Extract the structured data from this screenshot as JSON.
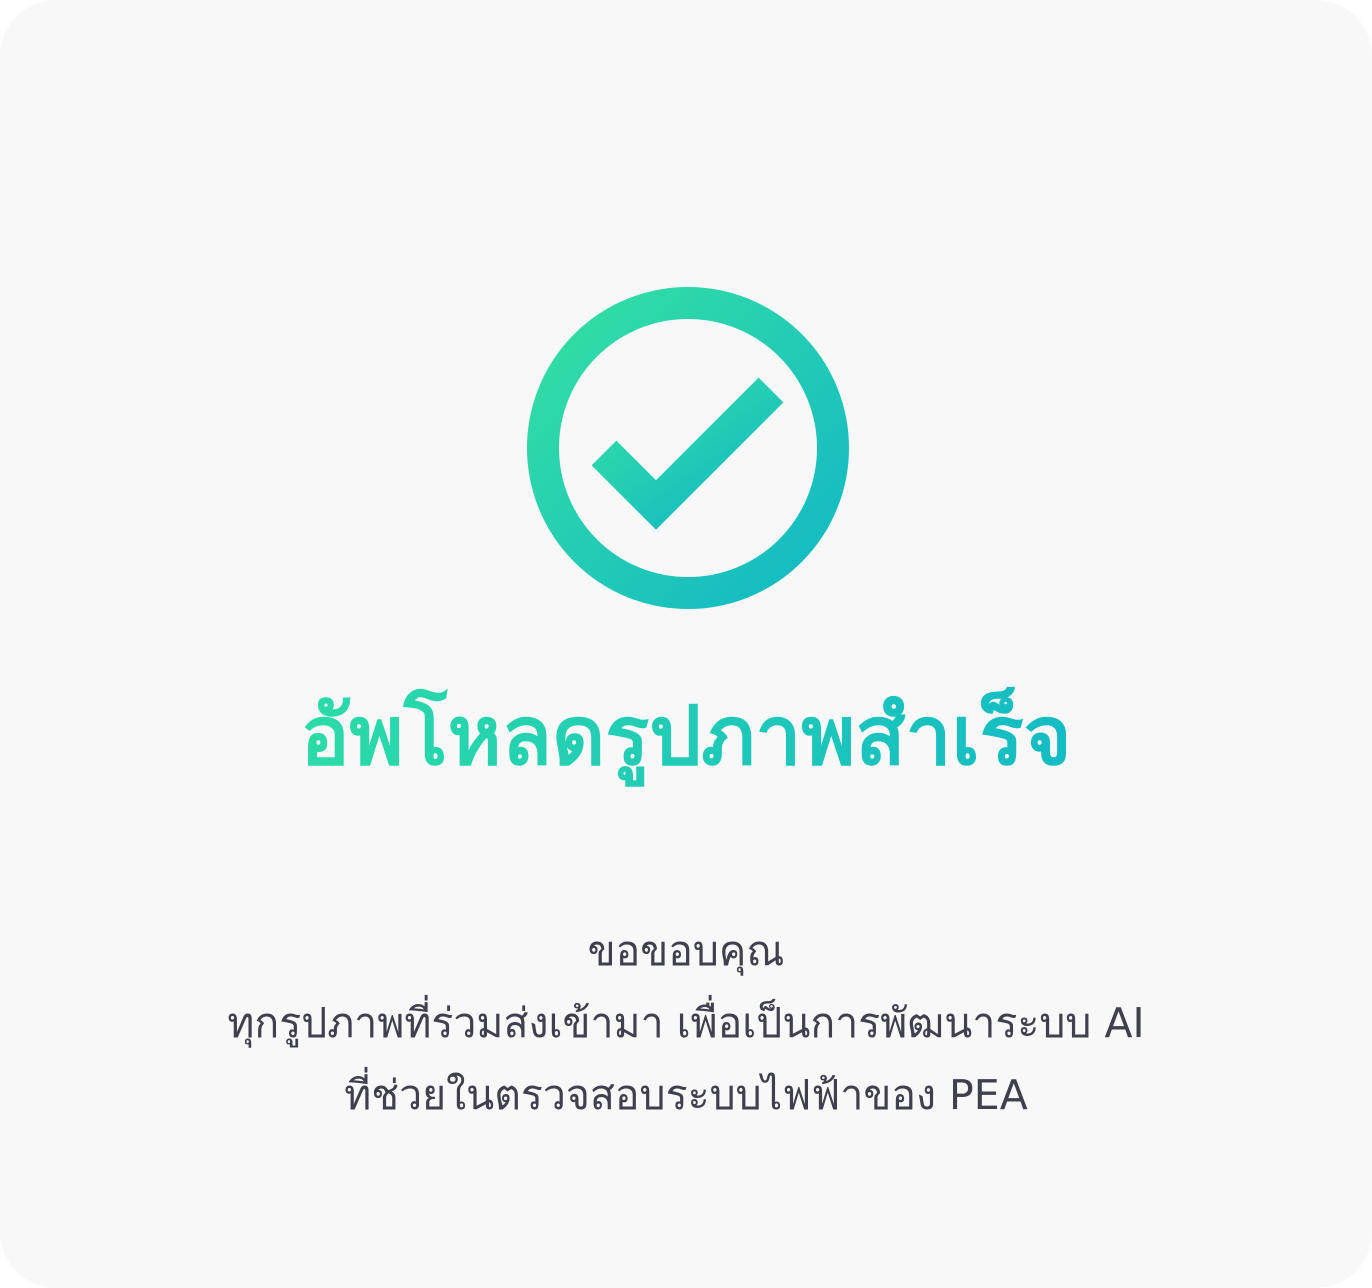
{
  "dialog": {
    "icon": "check-circle-icon",
    "title": "อัพโหลดรูปภาพสำเร็จ",
    "message_lines": [
      "ขอขอบคุณ",
      "ทุกรูปภาพที่ร่วมส่งเข้ามา เพื่อเป็นการพัฒนาระบบ AI",
      "ที่ช่วยในตรวจสอบระบบไฟฟ้าของ PEA"
    ]
  },
  "colors": {
    "card_background": "#f8f8f9",
    "accent_gradient_start": "#34e0a1",
    "accent_gradient_end": "#12b8c6",
    "message_text": "#3f3f4d"
  }
}
